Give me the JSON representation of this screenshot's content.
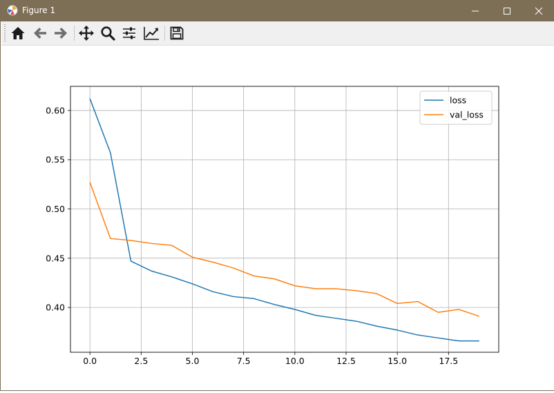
{
  "window": {
    "title": "Figure 1",
    "titlebar_color": "#7d6e56"
  },
  "toolbar": {
    "buttons": [
      {
        "name": "home",
        "icon": "home-icon"
      },
      {
        "name": "back",
        "icon": "arrow-left-icon"
      },
      {
        "name": "forward",
        "icon": "arrow-right-icon"
      },
      {
        "name": "pan",
        "icon": "move-icon"
      },
      {
        "name": "zoom",
        "icon": "zoom-icon"
      },
      {
        "name": "subplots",
        "icon": "sliders-icon"
      },
      {
        "name": "axes",
        "icon": "line-chart-icon"
      },
      {
        "name": "save",
        "icon": "save-icon"
      }
    ]
  },
  "chart_data": {
    "type": "line",
    "x": [
      0,
      1,
      2,
      3,
      4,
      5,
      6,
      7,
      8,
      9,
      10,
      11,
      12,
      13,
      14,
      15,
      16,
      17,
      18,
      19
    ],
    "xlim": [
      -0.95,
      19.95
    ],
    "ylim": [
      0.3545,
      0.6245
    ],
    "xticks": [
      0.0,
      2.5,
      5.0,
      7.5,
      10.0,
      12.5,
      15.0,
      17.5
    ],
    "xtick_labels": [
      "0.0",
      "2.5",
      "5.0",
      "7.5",
      "10.0",
      "12.5",
      "15.0",
      "17.5"
    ],
    "yticks": [
      0.4,
      0.45,
      0.5,
      0.55,
      0.6
    ],
    "ytick_labels": [
      "0.40",
      "0.45",
      "0.50",
      "0.55",
      "0.60"
    ],
    "grid": true,
    "legend_position": "top-right",
    "series": [
      {
        "name": "loss",
        "color": "#1f77b4",
        "values": [
          0.612,
          0.557,
          0.447,
          0.437,
          0.431,
          0.424,
          0.416,
          0.411,
          0.409,
          0.403,
          0.398,
          0.392,
          0.389,
          0.386,
          0.381,
          0.377,
          0.372,
          0.369,
          0.366,
          0.366
        ]
      },
      {
        "name": "val_loss",
        "color": "#ff7f0e",
        "values": [
          0.527,
          0.47,
          0.468,
          0.465,
          0.463,
          0.451,
          0.446,
          0.44,
          0.432,
          0.429,
          0.422,
          0.419,
          0.419,
          0.417,
          0.414,
          0.404,
          0.406,
          0.395,
          0.398,
          0.391
        ]
      }
    ]
  }
}
